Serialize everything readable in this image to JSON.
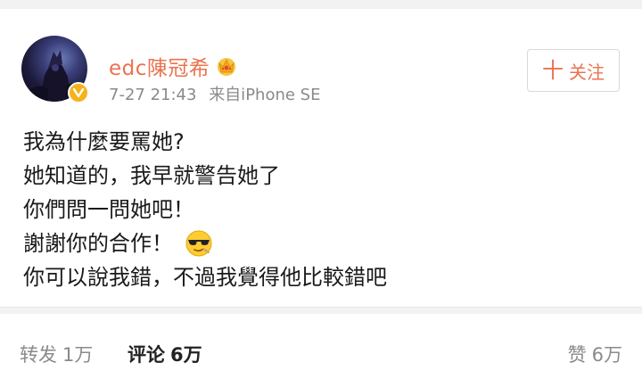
{
  "post": {
    "author": {
      "name": "edc陳冠希",
      "verified": true,
      "badge_color": "#f6b21b",
      "member_badge_icon": "crown-icon"
    },
    "timestamp": "7-27 21:43",
    "source": "来自iPhone SE",
    "follow_label": "关注",
    "follow_plus": "十",
    "lines": [
      "我為什麼要罵她?",
      "她知道的，我早就警告她了",
      "你們問一問她吧！",
      "謝謝你的合作！",
      "你可以說我錯，不過我覺得他比較錯吧"
    ],
    "emoji": "sunglasses-face-icon"
  },
  "actions": {
    "repost": {
      "label": "转发",
      "count": "1万"
    },
    "comment": {
      "label": "评论",
      "count": "6万"
    },
    "like": {
      "label": "赞",
      "count": "6万"
    }
  },
  "colors": {
    "accent": "#eb7350",
    "meta_text": "#8a8a8a",
    "background": "#f2f2f2"
  }
}
